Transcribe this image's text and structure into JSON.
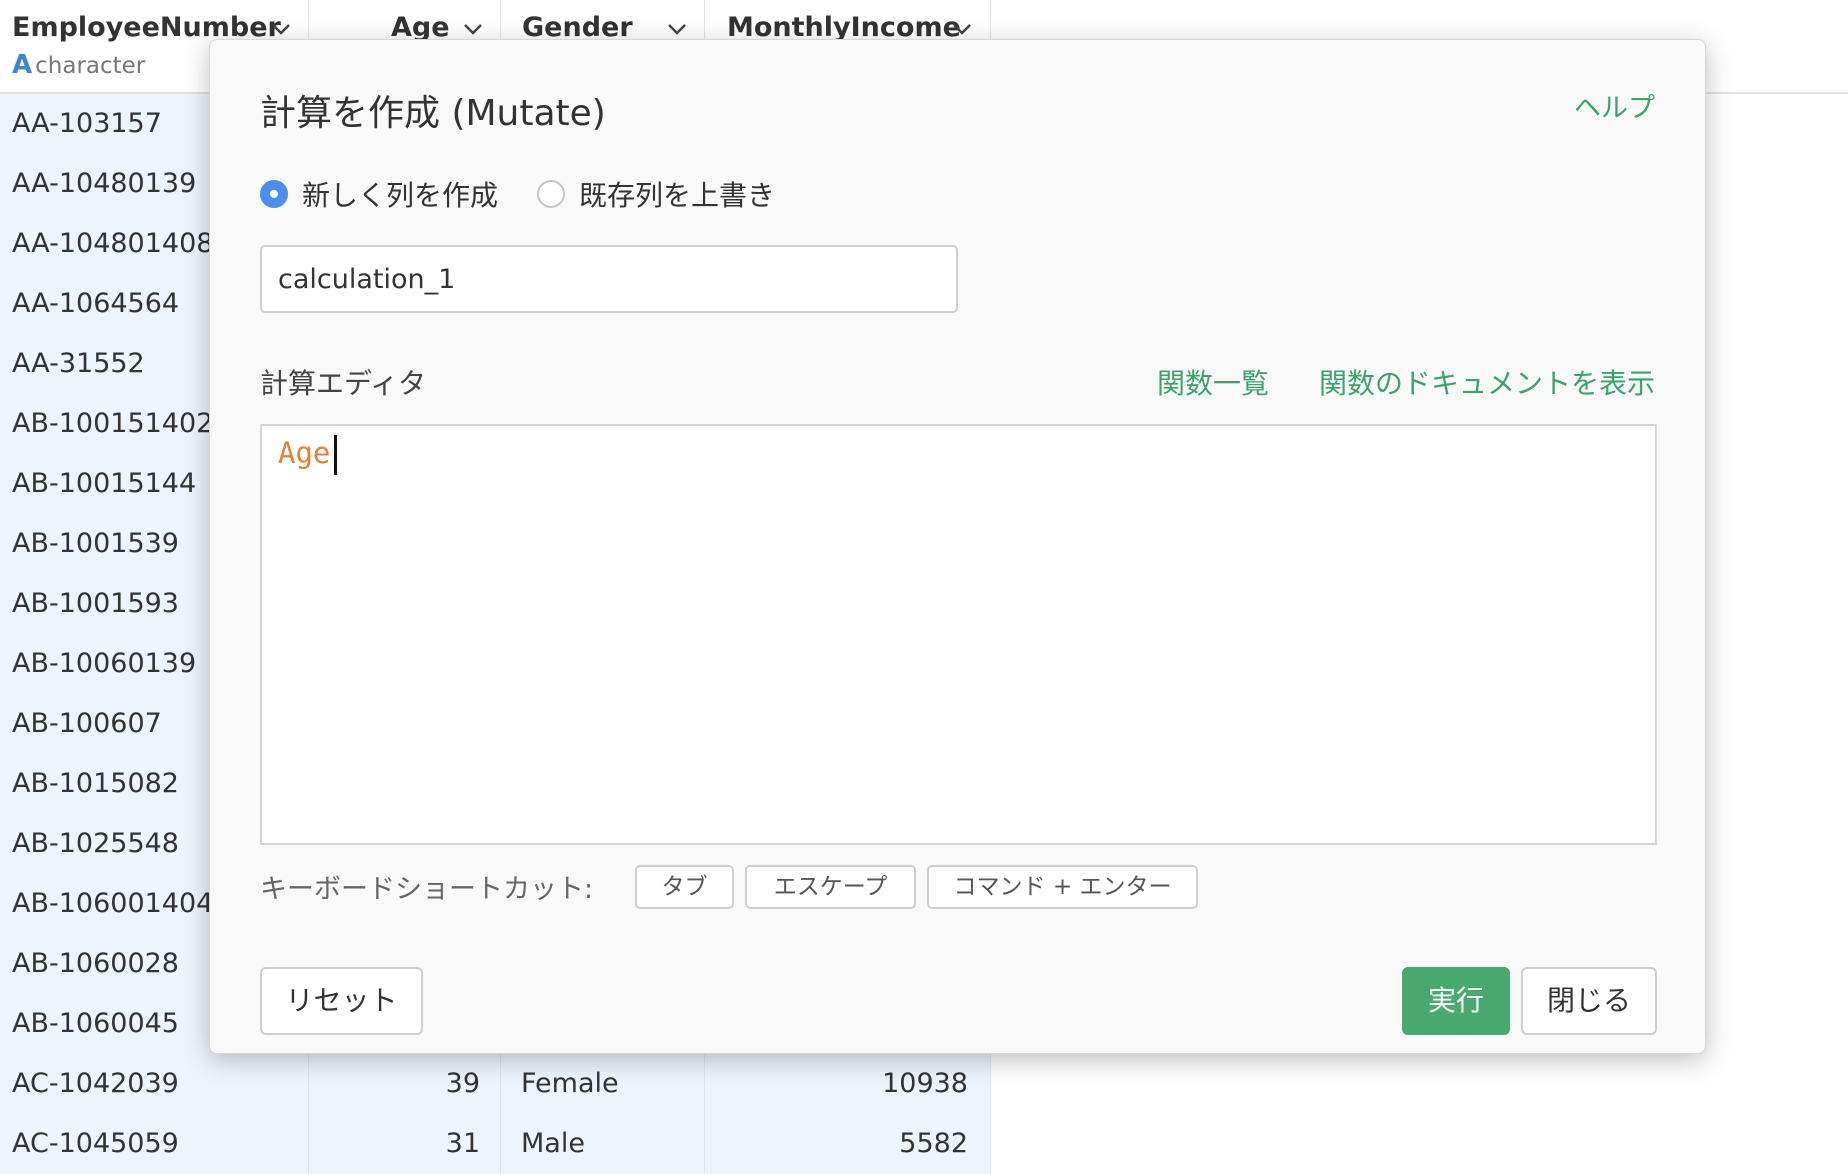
{
  "table": {
    "columns": [
      {
        "name": "EmployeeNumber",
        "type_icon": "A",
        "type": "character"
      },
      {
        "name": "Age"
      },
      {
        "name": "Gender"
      },
      {
        "name": "MonthlyIncome"
      }
    ],
    "rows": [
      {
        "id": "AA-103157",
        "age": "",
        "gender": "",
        "income": ""
      },
      {
        "id": "AA-10480139",
        "age": "",
        "gender": "",
        "income": ""
      },
      {
        "id": "AA-104801408",
        "age": "",
        "gender": "",
        "income": ""
      },
      {
        "id": "AA-1064564",
        "age": "",
        "gender": "",
        "income": ""
      },
      {
        "id": "AA-31552",
        "age": "",
        "gender": "",
        "income": ""
      },
      {
        "id": "AB-100151402",
        "age": "",
        "gender": "",
        "income": ""
      },
      {
        "id": "AB-10015144",
        "age": "",
        "gender": "",
        "income": ""
      },
      {
        "id": "AB-1001539",
        "age": "",
        "gender": "",
        "income": ""
      },
      {
        "id": "AB-1001593",
        "age": "",
        "gender": "",
        "income": ""
      },
      {
        "id": "AB-10060139",
        "age": "",
        "gender": "",
        "income": ""
      },
      {
        "id": "AB-100607",
        "age": "",
        "gender": "",
        "income": ""
      },
      {
        "id": "AB-1015082",
        "age": "",
        "gender": "",
        "income": ""
      },
      {
        "id": "AB-1025548",
        "age": "",
        "gender": "",
        "income": ""
      },
      {
        "id": "AB-106001404",
        "age": "",
        "gender": "",
        "income": ""
      },
      {
        "id": "AB-1060028",
        "age": "",
        "gender": "",
        "income": ""
      },
      {
        "id": "AB-1060045",
        "age": "",
        "gender": "",
        "income": ""
      },
      {
        "id": "AC-1042039",
        "age": "39",
        "gender": "Female",
        "income": "10938"
      },
      {
        "id": "AC-1045059",
        "age": "31",
        "gender": "Male",
        "income": "5582"
      }
    ]
  },
  "modal": {
    "title": "計算を作成 (Mutate)",
    "help": "ヘルプ",
    "radio_new": "新しく列を作成",
    "radio_overwrite": "既存列を上書き",
    "column_name_value": "calculation_1",
    "editor_label": "計算エディタ",
    "function_list": "関数一覧",
    "function_docs": "関数のドキュメントを表示",
    "editor_code": "Age",
    "shortcut_label": "キーボードショートカット:",
    "shortcut_tab": "タブ",
    "shortcut_escape": "エスケープ",
    "shortcut_cmd_enter": "コマンド + エンター",
    "reset": "リセット",
    "run": "実行",
    "close": "閉じる"
  }
}
